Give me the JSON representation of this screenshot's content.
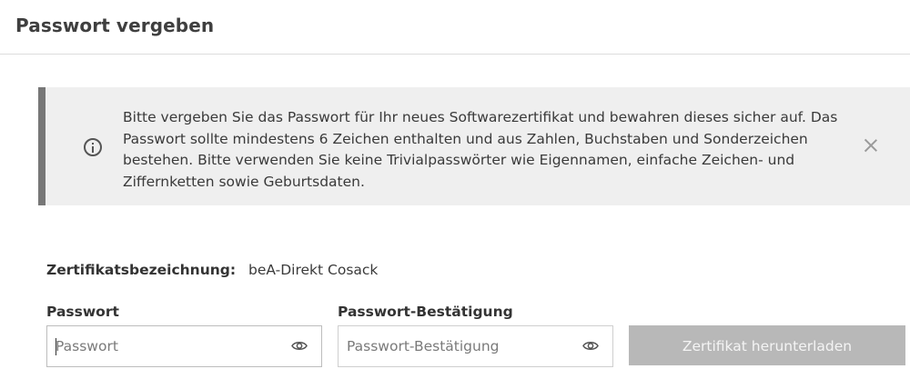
{
  "header": {
    "title": "Passwort vergeben"
  },
  "info": {
    "icon": "info-icon",
    "text": "Bitte vergeben Sie das Passwort für Ihr neues Softwarezertifikat und bewahren dieses sicher auf. Das Passwort sollte mindestens 6 Zeichen enthalten und aus Zahlen, Buchstaben und Sonderzeichen bestehen. Bitte verwenden Sie keine Trivialpasswörter wie Eigennamen, einfache Zeichen- und Ziffernketten sowie Geburtsdaten.",
    "close_icon": "close-icon"
  },
  "certificate": {
    "label": "Zertifikatsbezeichnung:",
    "value": "beA-Direkt Cosack"
  },
  "password": {
    "label": "Passwort",
    "placeholder": "Passwort",
    "value": "",
    "icon": "eye-icon"
  },
  "password_confirm": {
    "label": "Passwort-Bestätigung",
    "placeholder": "Passwort-Bestätigung",
    "value": "",
    "icon": "eye-icon"
  },
  "download_button": {
    "label": "Zertifikat herunterladen",
    "enabled": false
  },
  "colors": {
    "info_background": "#efefef",
    "info_accent": "#777777",
    "button_disabled": "#b8b8b8"
  }
}
